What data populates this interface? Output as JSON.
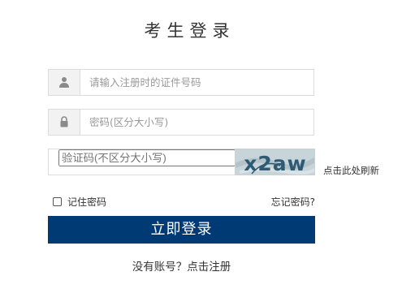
{
  "title": "考生登录",
  "id_field": {
    "placeholder": "请输入注册时的证件号码",
    "icon": "user-icon"
  },
  "password_field": {
    "placeholder": "密码(区分大小写)",
    "icon": "lock-icon"
  },
  "captcha": {
    "placeholder": "验证码(不区分大小写)",
    "image_text": "x2aw",
    "refresh_label": "点击此处刷新"
  },
  "remember_label": "记住密码",
  "forgot_label": "忘记密码?",
  "login_label": "立即登录",
  "register_label": "没有账号？点击注册",
  "colors": {
    "primary": "#003a75",
    "border": "#dcdcdc",
    "icon_bg": "#f2f2f2"
  }
}
